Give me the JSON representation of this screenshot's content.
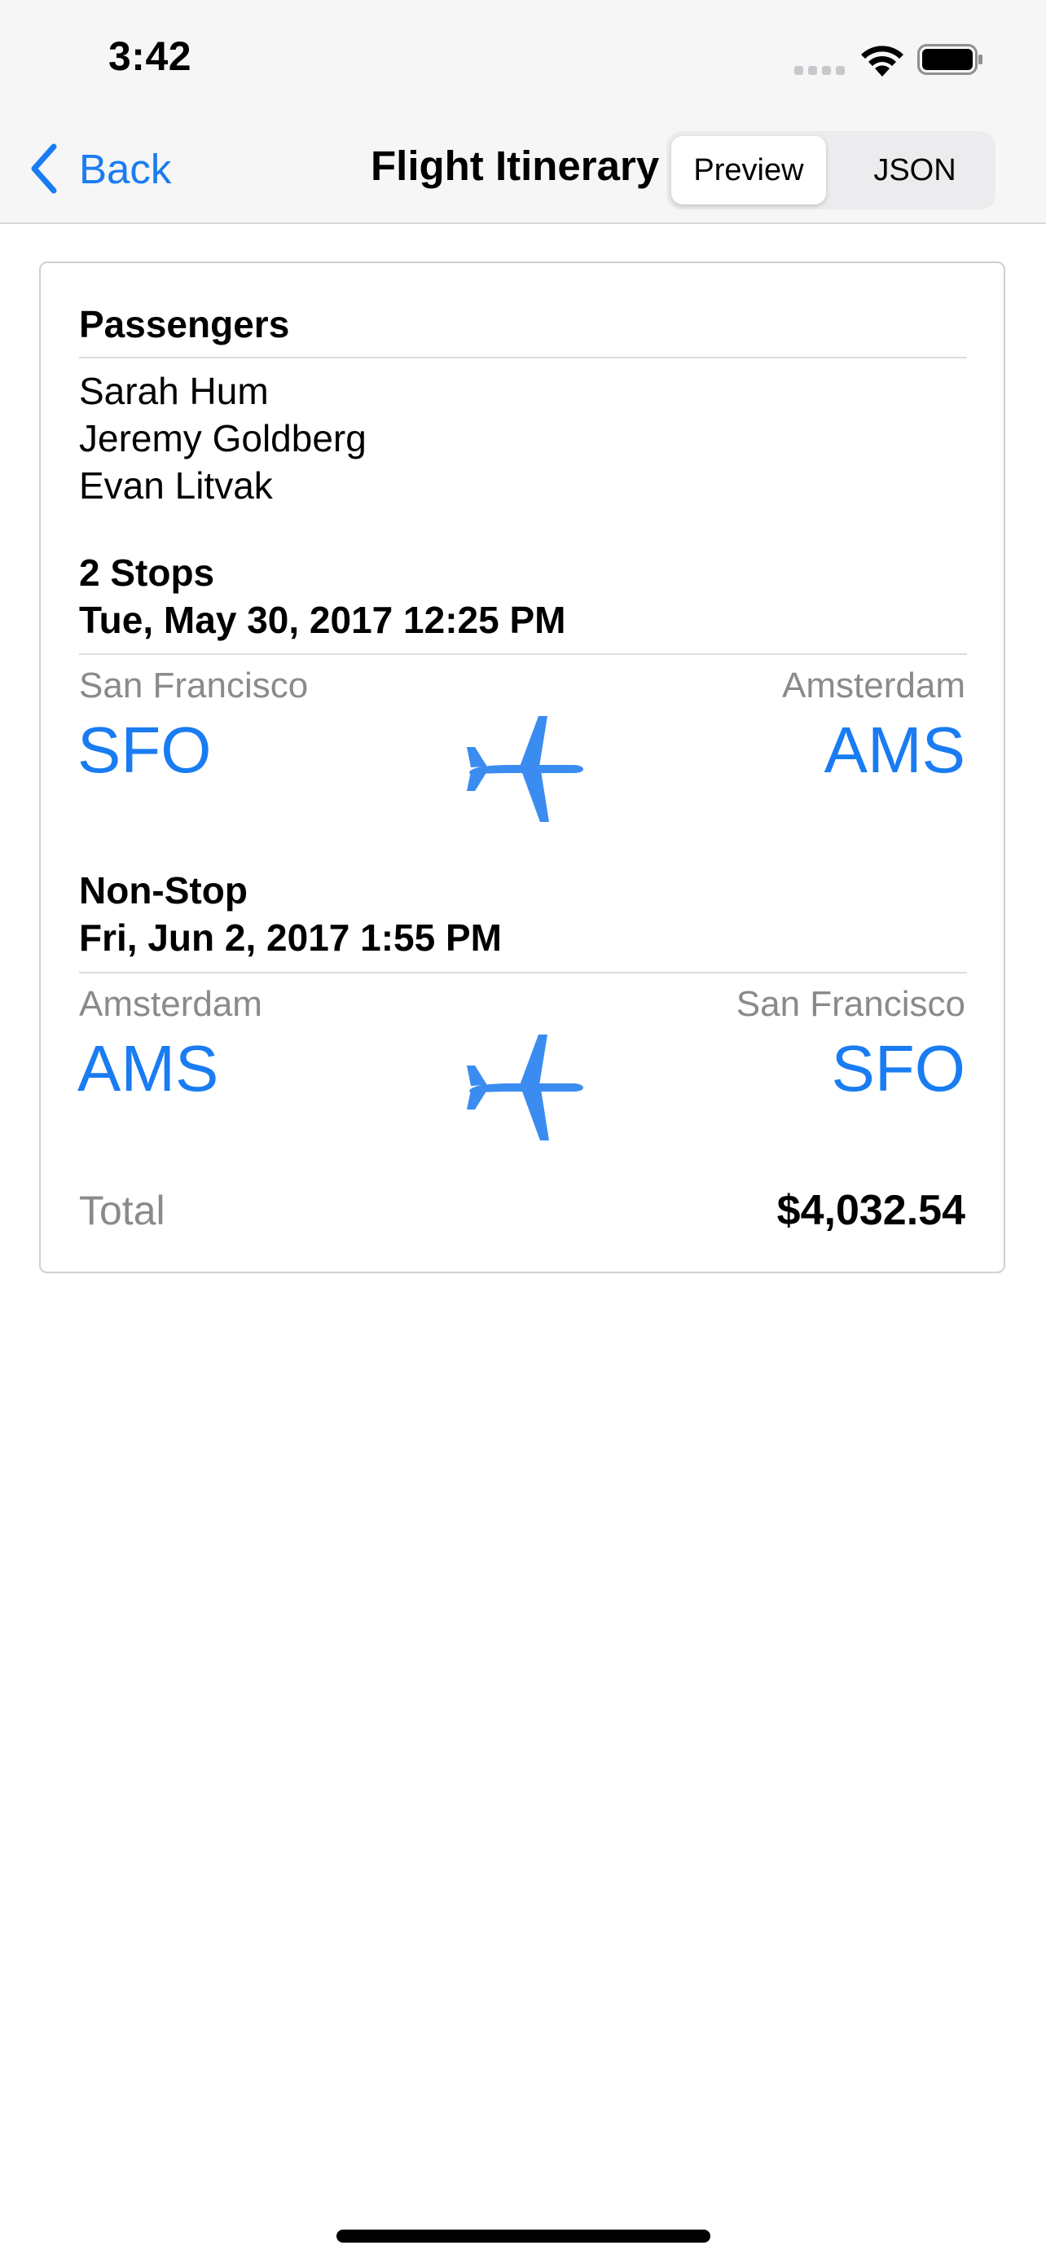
{
  "status_bar": {
    "time": "3:42"
  },
  "nav": {
    "back_label": "Back",
    "title": "Flight Itinerary",
    "segments": [
      "Preview",
      "JSON"
    ],
    "selected_segment": "Preview"
  },
  "itinerary": {
    "passengers_heading": "Passengers",
    "passengers": [
      "Sarah Hum",
      "Jeremy Goldberg",
      "Evan Litvak"
    ],
    "segments": [
      {
        "stops": "2 Stops",
        "datetime": "Tue, May 30, 2017 12:25 PM",
        "origin_city": "San Francisco",
        "origin_code": "SFO",
        "destination_city": "Amsterdam",
        "destination_code": "AMS"
      },
      {
        "stops": "Non-Stop",
        "datetime": "Fri, Jun 2, 2017 1:55 PM",
        "origin_city": "Amsterdam",
        "origin_code": "AMS",
        "destination_city": "San Francisco",
        "destination_code": "SFO"
      }
    ],
    "total_label": "Total",
    "total_value": "$4,032.54"
  },
  "colors": {
    "accent": "#1a7cf2",
    "plane": "#3a8cf0",
    "secondary_text": "#8a8a8e"
  },
  "icons": [
    "chevron-left-icon",
    "airplane-icon",
    "wifi-icon",
    "battery-icon",
    "cellular-signal-icon"
  ]
}
